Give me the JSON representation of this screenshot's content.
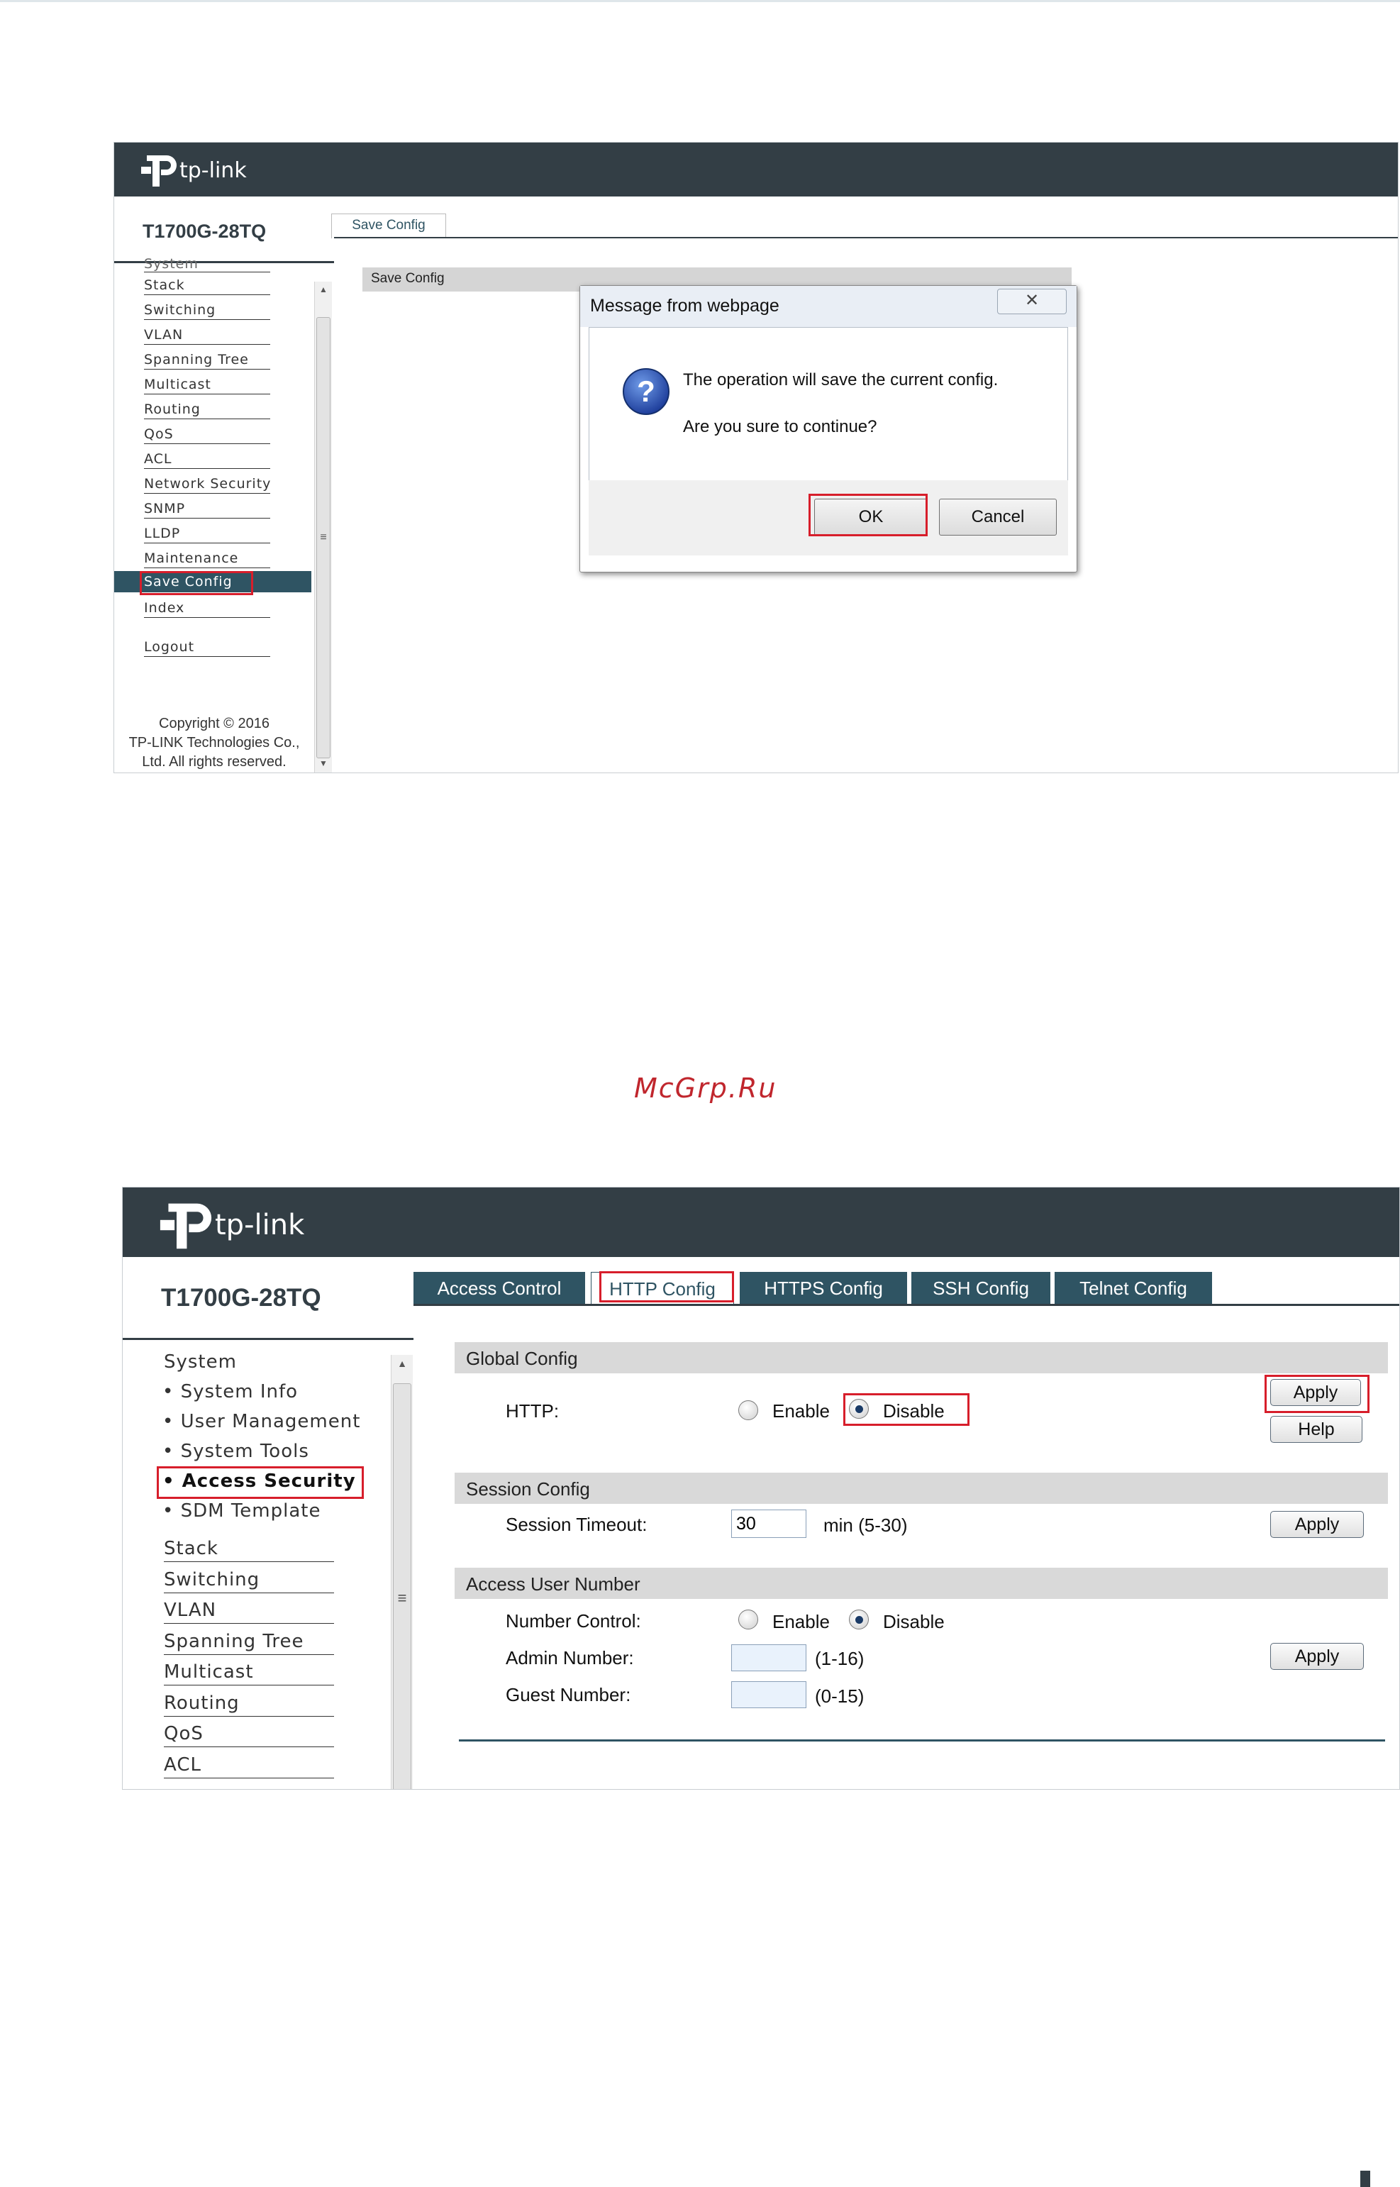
{
  "watermark": "McGrp.Ru",
  "screenshot1": {
    "brand": "tp-link",
    "model": "T1700G-28TQ",
    "tab": "Save Config",
    "section_bar": "Save Config",
    "sidebar_partial": "System",
    "sidebar": [
      "Stack",
      "Switching",
      "VLAN",
      "Spanning Tree",
      "Multicast",
      "Routing",
      "QoS",
      "ACL",
      "Network Security",
      "SNMP",
      "LLDP",
      "Maintenance",
      "Save Config",
      "Index"
    ],
    "logout": "Logout",
    "copyright": [
      "Copyright © 2016",
      "TP-LINK Technologies Co.,",
      "Ltd. All rights reserved."
    ],
    "dialog": {
      "title": "Message from webpage",
      "line1": "The operation will save the current config.",
      "line2": "Are you sure to continue?",
      "ok": "OK",
      "cancel": "Cancel"
    }
  },
  "screenshot2": {
    "brand": "tp-link",
    "model": "T1700G-28TQ",
    "tabs": [
      "Access Control",
      "HTTP Config",
      "HTTPS Config",
      "SSH Config",
      "Telnet Config"
    ],
    "sidebar": {
      "system": "System",
      "sub": [
        "System Info",
        "User Management",
        "System Tools",
        "Access Security",
        "SDM Template"
      ],
      "items": [
        "Stack",
        "Switching",
        "VLAN",
        "Spanning Tree",
        "Multicast",
        "Routing",
        "QoS",
        "ACL"
      ]
    },
    "global": {
      "title": "Global Config",
      "http_label": "HTTP:",
      "enable": "Enable",
      "disable": "Disable",
      "apply": "Apply",
      "help": "Help"
    },
    "session": {
      "title": "Session Config",
      "timeout_label": "Session Timeout:",
      "timeout_value": "30",
      "range": "min (5-30)",
      "apply": "Apply"
    },
    "access": {
      "title": "Access User Number",
      "number_control": "Number Control:",
      "enable": "Enable",
      "disable": "Disable",
      "admin_label": "Admin Number:",
      "admin_range": "(1-16)",
      "guest_label": "Guest Number:",
      "guest_range": "(0-15)",
      "apply": "Apply"
    }
  }
}
